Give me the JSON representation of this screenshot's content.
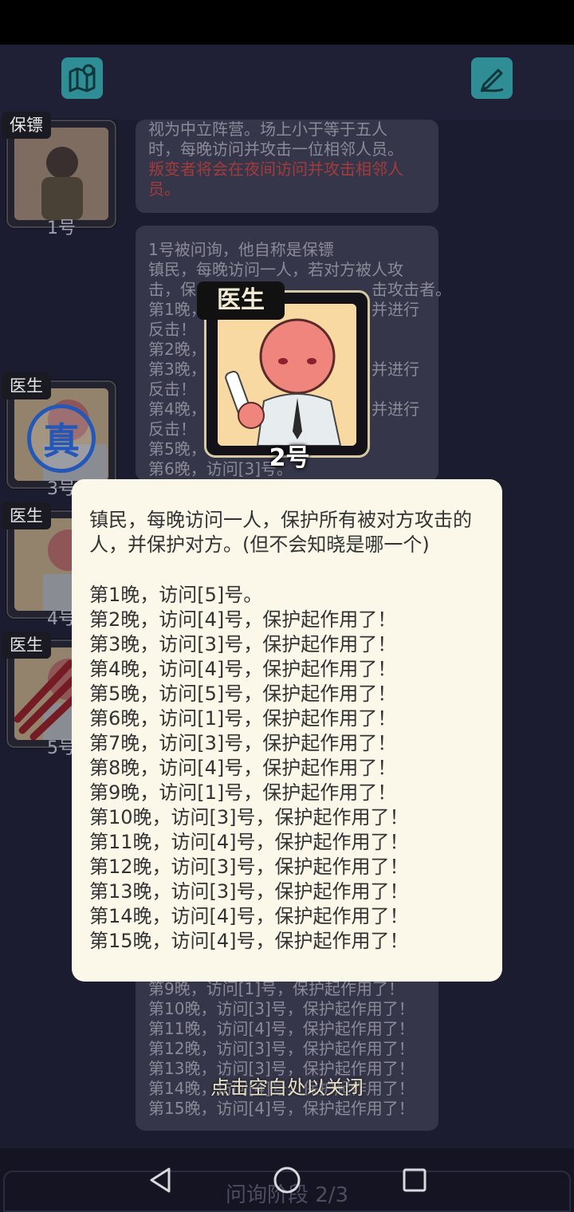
{
  "header": {
    "map_icon": "map-pin-icon",
    "notes_icon": "pen-edit-icon"
  },
  "players": [
    {
      "role": "保镖",
      "num": "1号"
    },
    {
      "role": "医生",
      "num": "3号",
      "badge": "真"
    },
    {
      "role": "医生",
      "num": "4号"
    },
    {
      "role": "医生",
      "num": "5号"
    }
  ],
  "bubble1": {
    "lines": [
      "视为中立阵营。场上小于等于五人",
      "时，每晚访问并攻击一位相邻人员。"
    ],
    "red_lines": [
      "叛变者将会在夜间访问并攻击相邻人",
      "员。"
    ]
  },
  "bubble2": {
    "lines": [
      "1号被问询，他自称是保镖",
      "镇民，每晚访问一人，若对方被人攻",
      "击，保",
      "第1晚，",
      "反击！",
      "第2晚，",
      "第3晚，",
      "反击！",
      "第4晚，",
      "反击！",
      "第5晚，",
      "第6晚，访问[3]号。"
    ],
    "right_frags": [
      "击攻击者。",
      "并进行",
      "并进行",
      "并进行"
    ]
  },
  "bubble3": {
    "lines": [
      "第9晚，访问[1]号，保护起作用了！",
      "第10晚，访问[3]号，保护起作用了！",
      "第11晚，访问[4]号，保护起作用了！",
      "第12晚，访问[3]号，保护起作用了！",
      "第13晚，访问[3]号，保护起作用了！",
      "第14晚，访问[4]号，保护起作用了！",
      "第15晚，访问[4]号，保护起作用了！"
    ]
  },
  "big_card": {
    "role": "医生",
    "num": "2号"
  },
  "popup": {
    "description": "镇民，每晚访问一人，保护所有被对方攻击的人，并保护对方。(但不会知晓是哪一个)",
    "nights": [
      "第1晚，访问[5]号。",
      "第2晚，访问[4]号，保护起作用了！",
      "第3晚，访问[3]号，保护起作用了！",
      "第4晚，访问[4]号，保护起作用了！",
      "第5晚，访问[5]号，保护起作用了！",
      "第6晚，访问[1]号，保护起作用了！",
      "第7晚，访问[3]号，保护起作用了！",
      "第8晚，访问[4]号，保护起作用了！",
      "第9晚，访问[1]号，保护起作用了！",
      "第10晚，访问[3]号，保护起作用了！",
      "第11晚，访问[4]号，保护起作用了！",
      "第12晚，访问[3]号，保护起作用了！",
      "第13晚，访问[3]号，保护起作用了！",
      "第14晚，访问[4]号，保护起作用了！",
      "第15晚，访问[4]号，保护起作用了！"
    ]
  },
  "close_hint": "点击空白处以关闭",
  "phase": "问询阶段 2/3",
  "nav": {
    "back": "back-triangle-icon",
    "home": "home-circle-icon",
    "recents": "recents-square-icon"
  }
}
